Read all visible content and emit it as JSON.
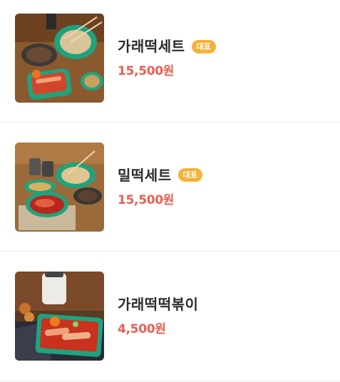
{
  "menu": {
    "items": [
      {
        "name": "가래떡세트",
        "badge": "대표",
        "price": "15,500원",
        "image_icon": "tteokbokki-set-photo"
      },
      {
        "name": "밀떡세트",
        "badge": "대표",
        "price": "15,500원",
        "image_icon": "wheat-tteokbokki-set-photo"
      },
      {
        "name": "가래떡떡볶이",
        "badge": "",
        "price": "4,500원",
        "image_icon": "garae-tteokbokki-photo"
      }
    ]
  },
  "colors": {
    "price": "#ee5d50",
    "badge": "#f7b03a",
    "name": "#2b2b2b",
    "divider": "#ececec"
  }
}
